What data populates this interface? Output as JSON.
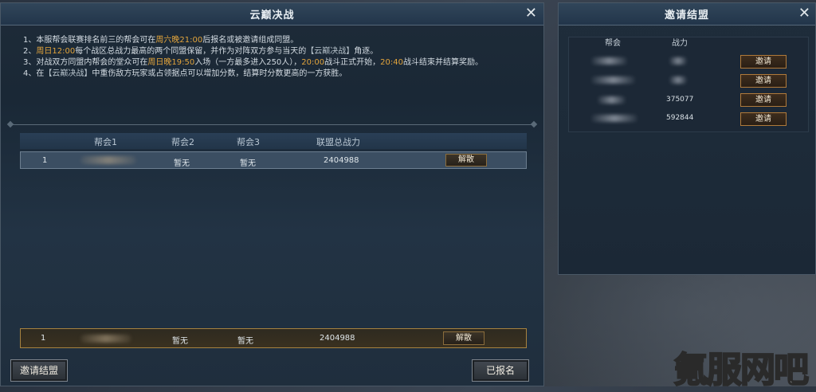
{
  "main": {
    "title": "云巅决战",
    "close": "✕",
    "rules": [
      {
        "parts": [
          {
            "t": "1、本服帮会联赛排名前三的帮会可在"
          },
          {
            "t": "周六晚21:00",
            "hl": true
          },
          {
            "t": "后报名或被邀请组成同盟。"
          }
        ]
      },
      {
        "parts": [
          {
            "t": "2、"
          },
          {
            "t": "周日12:00",
            "hl": true
          },
          {
            "t": "每个战区总战力最高的两个同盟保留，并作为对阵双方参与当天的"
          },
          {
            "t": "【云巅决战】",
            "br": true
          },
          {
            "t": "角逐。"
          }
        ]
      },
      {
        "parts": [
          {
            "t": "3、对战双方同盟内帮会的堂众可在"
          },
          {
            "t": "周日晚19:50",
            "hl": true
          },
          {
            "t": "入场（一方最多进入250人），"
          },
          {
            "t": "20:00",
            "hl": true
          },
          {
            "t": "战斗正式开始，"
          },
          {
            "t": "20:40",
            "hl": true
          },
          {
            "t": "战斗结束并结算奖励。"
          }
        ]
      },
      {
        "parts": [
          {
            "t": "4、在"
          },
          {
            "t": "【云巅决战】",
            "br": true
          },
          {
            "t": "中重伤敌方玩家或占领据点可以增加分数，结算时分数更高的一方获胜。"
          }
        ]
      }
    ],
    "headers": {
      "guild1": "帮会1",
      "guild2": "帮会2",
      "guild3": "帮会3",
      "power": "联盟总战力"
    },
    "row1": {
      "rank": "1",
      "guild2": "暂无",
      "guild3": "暂无",
      "power": "2404988",
      "action": "解散"
    },
    "row2": {
      "rank": "1",
      "guild2": "暂无",
      "guild3": "暂无",
      "power": "2404988",
      "action": "解散"
    },
    "invite_button": "邀请结盟",
    "registered_button": "已报名"
  },
  "side": {
    "title": "邀请结盟",
    "close": "✕",
    "headers": {
      "guild": "帮会",
      "power": "战力"
    },
    "rows": [
      {
        "power": "",
        "action": "邀请"
      },
      {
        "power": "",
        "action": "邀请"
      },
      {
        "power": "375077",
        "action": "邀请"
      },
      {
        "power": "592844",
        "action": "邀请"
      }
    ]
  },
  "watermark": "氪服网吧"
}
